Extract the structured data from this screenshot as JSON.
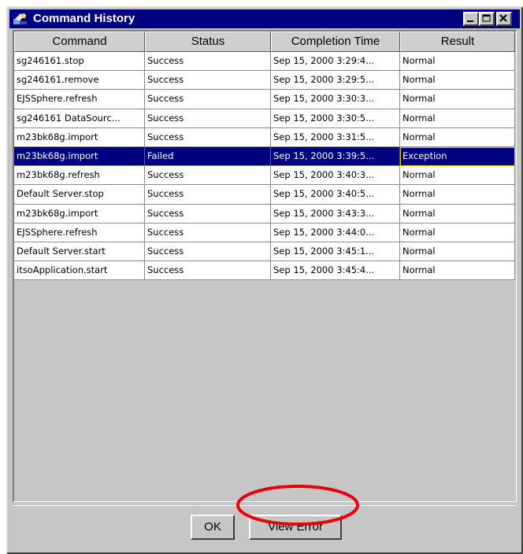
{
  "window": {
    "title": "Command History",
    "accent_color": "#000080",
    "highlight_color": "#e8000a"
  },
  "table": {
    "columns": [
      "Command",
      "Status",
      "Completion Time",
      "Result"
    ],
    "selected_row": 5,
    "rows": [
      [
        "sg246161.stop",
        "Success",
        "Sep 15, 2000 3:29:4...",
        "Normal"
      ],
      [
        "sg246161.remove",
        "Success",
        "Sep 15, 2000 3:29:5...",
        "Normal"
      ],
      [
        "EJSSphere.refresh",
        "Success",
        "Sep 15, 2000 3:30:3...",
        "Normal"
      ],
      [
        "sg246161 DataSourc...",
        "Success",
        "Sep 15, 2000 3:30:5...",
        "Normal"
      ],
      [
        "m23bk68g.import",
        "Success",
        "Sep 15, 2000 3:31:5...",
        "Normal"
      ],
      [
        "m23bk68g.import",
        "Failed",
        "Sep 15, 2000 3:39:5...",
        "Exception"
      ],
      [
        "m23bk68g.refresh",
        "Success",
        "Sep 15, 2000 3:40:3...",
        "Normal"
      ],
      [
        "Default Server.stop",
        "Success",
        "Sep 15, 2000 3:40:5...",
        "Normal"
      ],
      [
        "m23bk68g.import",
        "Success",
        "Sep 15, 2000 3:43:3...",
        "Normal"
      ],
      [
        "EJSSphere.refresh",
        "Success",
        "Sep 15, 2000 3:44:0...",
        "Normal"
      ],
      [
        "Default Server.start",
        "Success",
        "Sep 15, 2000 3:45:1...",
        "Normal"
      ],
      [
        "itsoApplication.start",
        "Success",
        "Sep 15, 2000 3:45:4...",
        "Normal"
      ]
    ]
  },
  "buttons": {
    "ok": "OK",
    "view_error": "View Error"
  }
}
